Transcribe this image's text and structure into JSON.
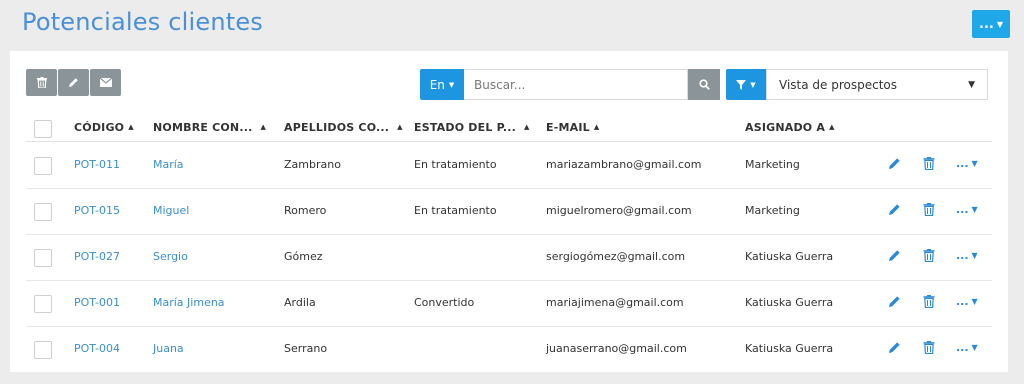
{
  "page": {
    "title": "Potenciales clientes",
    "header_menu_label": "...",
    "accent_color": "#1e95e0"
  },
  "toolbar": {
    "buttons": [
      {
        "icon": "trash-icon"
      },
      {
        "icon": "pencil-icon"
      },
      {
        "icon": "envelope-icon"
      }
    ],
    "search_scope_label": "En",
    "search_placeholder": "Buscar...",
    "view_selected": "Vista de prospectos"
  },
  "table": {
    "columns": [
      {
        "label": "CÓDIGO"
      },
      {
        "label": "NOMBRE CON..."
      },
      {
        "label": "APELLIDOS CO..."
      },
      {
        "label": "ESTADO DEL P..."
      },
      {
        "label": "E-MAIL"
      },
      {
        "label": "ASIGNADO A"
      }
    ],
    "rows": [
      {
        "code": "POT-011",
        "name": "María",
        "surname": "Zambrano",
        "status": "En tratamiento",
        "email": "mariazambrano@gmail.com",
        "assigned": "Marketing",
        "more": "..."
      },
      {
        "code": "POT-015",
        "name": "Miguel",
        "surname": "Romero",
        "status": "En tratamiento",
        "email": "miguelromero@gmail.com",
        "assigned": "Marketing",
        "more": "..."
      },
      {
        "code": "POT-027",
        "name": "Sergio",
        "surname": "Gómez",
        "status": "",
        "email": "sergiogómez@gmail.com",
        "assigned": "Katiuska Guerra",
        "more": "..."
      },
      {
        "code": "POT-001",
        "name": "María Jimena",
        "surname": "Ardila",
        "status": "Convertido",
        "email": "mariajimena@gmail.com",
        "assigned": "Katiuska Guerra",
        "more": "..."
      },
      {
        "code": "POT-004",
        "name": "Juana",
        "surname": "Serrano",
        "status": "",
        "email": "juanaserrano@gmail.com",
        "assigned": "Katiuska Guerra",
        "more": "..."
      }
    ]
  }
}
